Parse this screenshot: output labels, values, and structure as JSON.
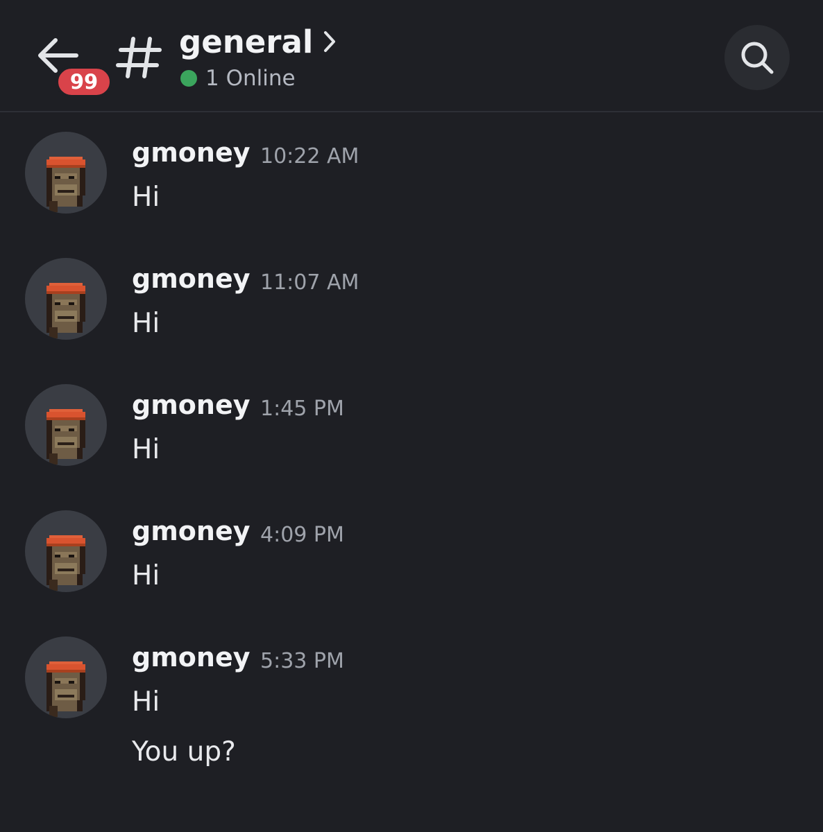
{
  "header": {
    "unread_badge": "99",
    "channel_name": "general",
    "online_text": "1 Online",
    "online_color": "#3ba55d",
    "badge_color": "#d9434a"
  },
  "messages": [
    {
      "username": "gmoney",
      "time": "10:22 AM",
      "lines": [
        "Hi"
      ]
    },
    {
      "username": "gmoney",
      "time": "11:07 AM",
      "lines": [
        "Hi"
      ]
    },
    {
      "username": "gmoney",
      "time": "1:45 PM",
      "lines": [
        "Hi"
      ]
    },
    {
      "username": "gmoney",
      "time": "4:09 PM",
      "lines": [
        "Hi"
      ]
    },
    {
      "username": "gmoney",
      "time": "5:33 PM",
      "lines": [
        "Hi",
        "You up?"
      ]
    }
  ],
  "icons": {
    "back": "arrow-left-icon",
    "channel": "hash-icon",
    "channel_details": "chevron-right-icon",
    "search": "search-icon",
    "avatar": "pixel-ape-avatar"
  },
  "colors": {
    "background": "#1e1f24",
    "divider": "#2d2f36",
    "search_bg": "#2a2c31"
  }
}
